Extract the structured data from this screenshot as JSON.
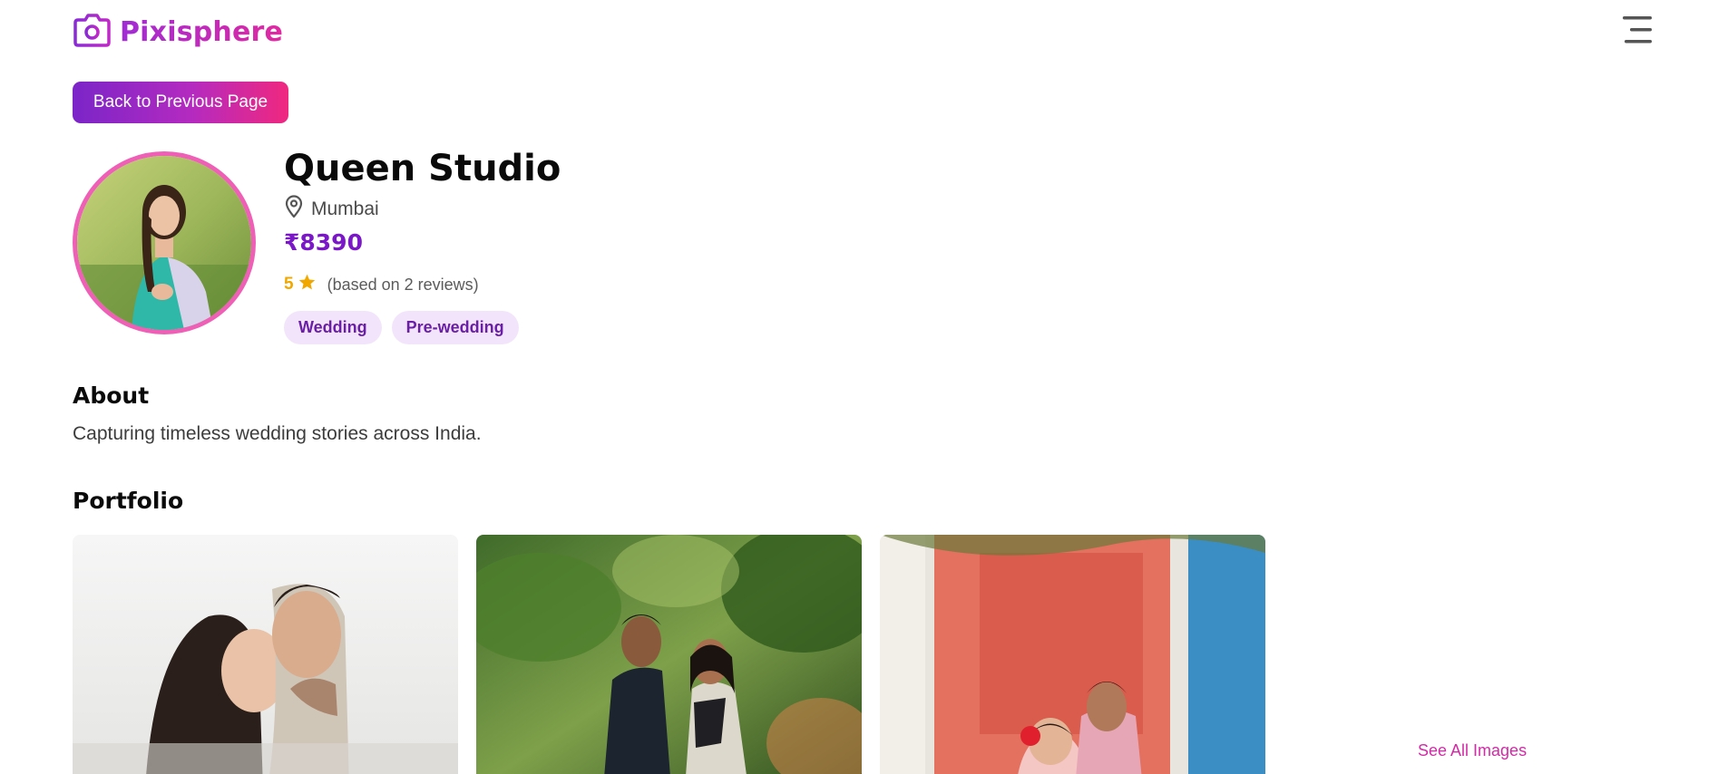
{
  "header": {
    "brand": "Pixisphere",
    "icons": {
      "logo": "camera-icon",
      "menu": "menu-icon"
    },
    "colors": {
      "brand_start": "#a02bd6",
      "brand_end": "#e02aa0"
    }
  },
  "back_button": {
    "label": "Back to Previous Page"
  },
  "studio": {
    "name": "Queen Studio",
    "location": "Mumbai",
    "price": "₹8390",
    "rating": "5",
    "reviews_text": "(based on 2 reviews)",
    "tags": [
      "Wedding",
      "Pre-wedding"
    ]
  },
  "about": {
    "title": "About",
    "text": "Capturing timeless wedding stories across India."
  },
  "portfolio": {
    "title": "Portfolio",
    "see_all": "See All Images"
  },
  "colors": {
    "accent": "#7a18c8",
    "rating": "#f0a800",
    "tag_bg": "#f2e5fb",
    "link": "#d22ba5"
  }
}
